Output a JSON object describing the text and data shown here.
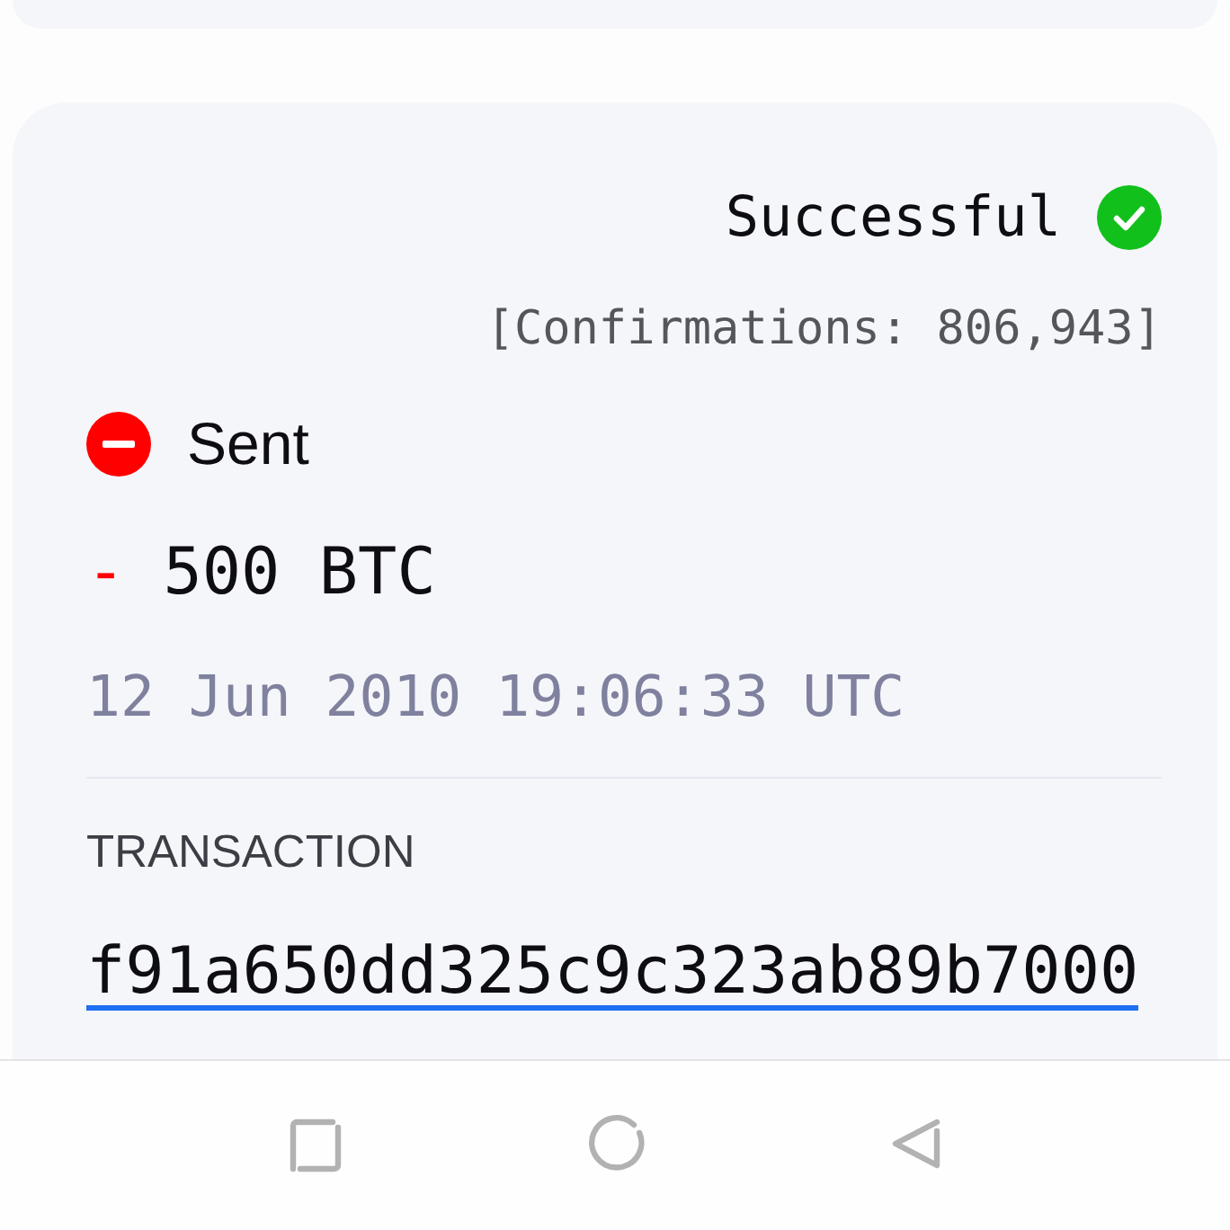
{
  "status": {
    "label": "Successful",
    "kind": "success"
  },
  "confirmations": "[Confirmations: 806,943]",
  "direction": {
    "label": "Sent",
    "kind": "sent"
  },
  "amount": {
    "sign": "-",
    "value": "500 BTC"
  },
  "timestamp": "12 Jun 2010 19:06:33 UTC",
  "transaction": {
    "heading": "TRANSACTION",
    "hash": "f91a650dd325c9c323ab89b7000"
  },
  "nav_bar": [
    {
      "kind": "recents"
    },
    {
      "kind": "home"
    },
    {
      "kind": "back"
    }
  ]
}
